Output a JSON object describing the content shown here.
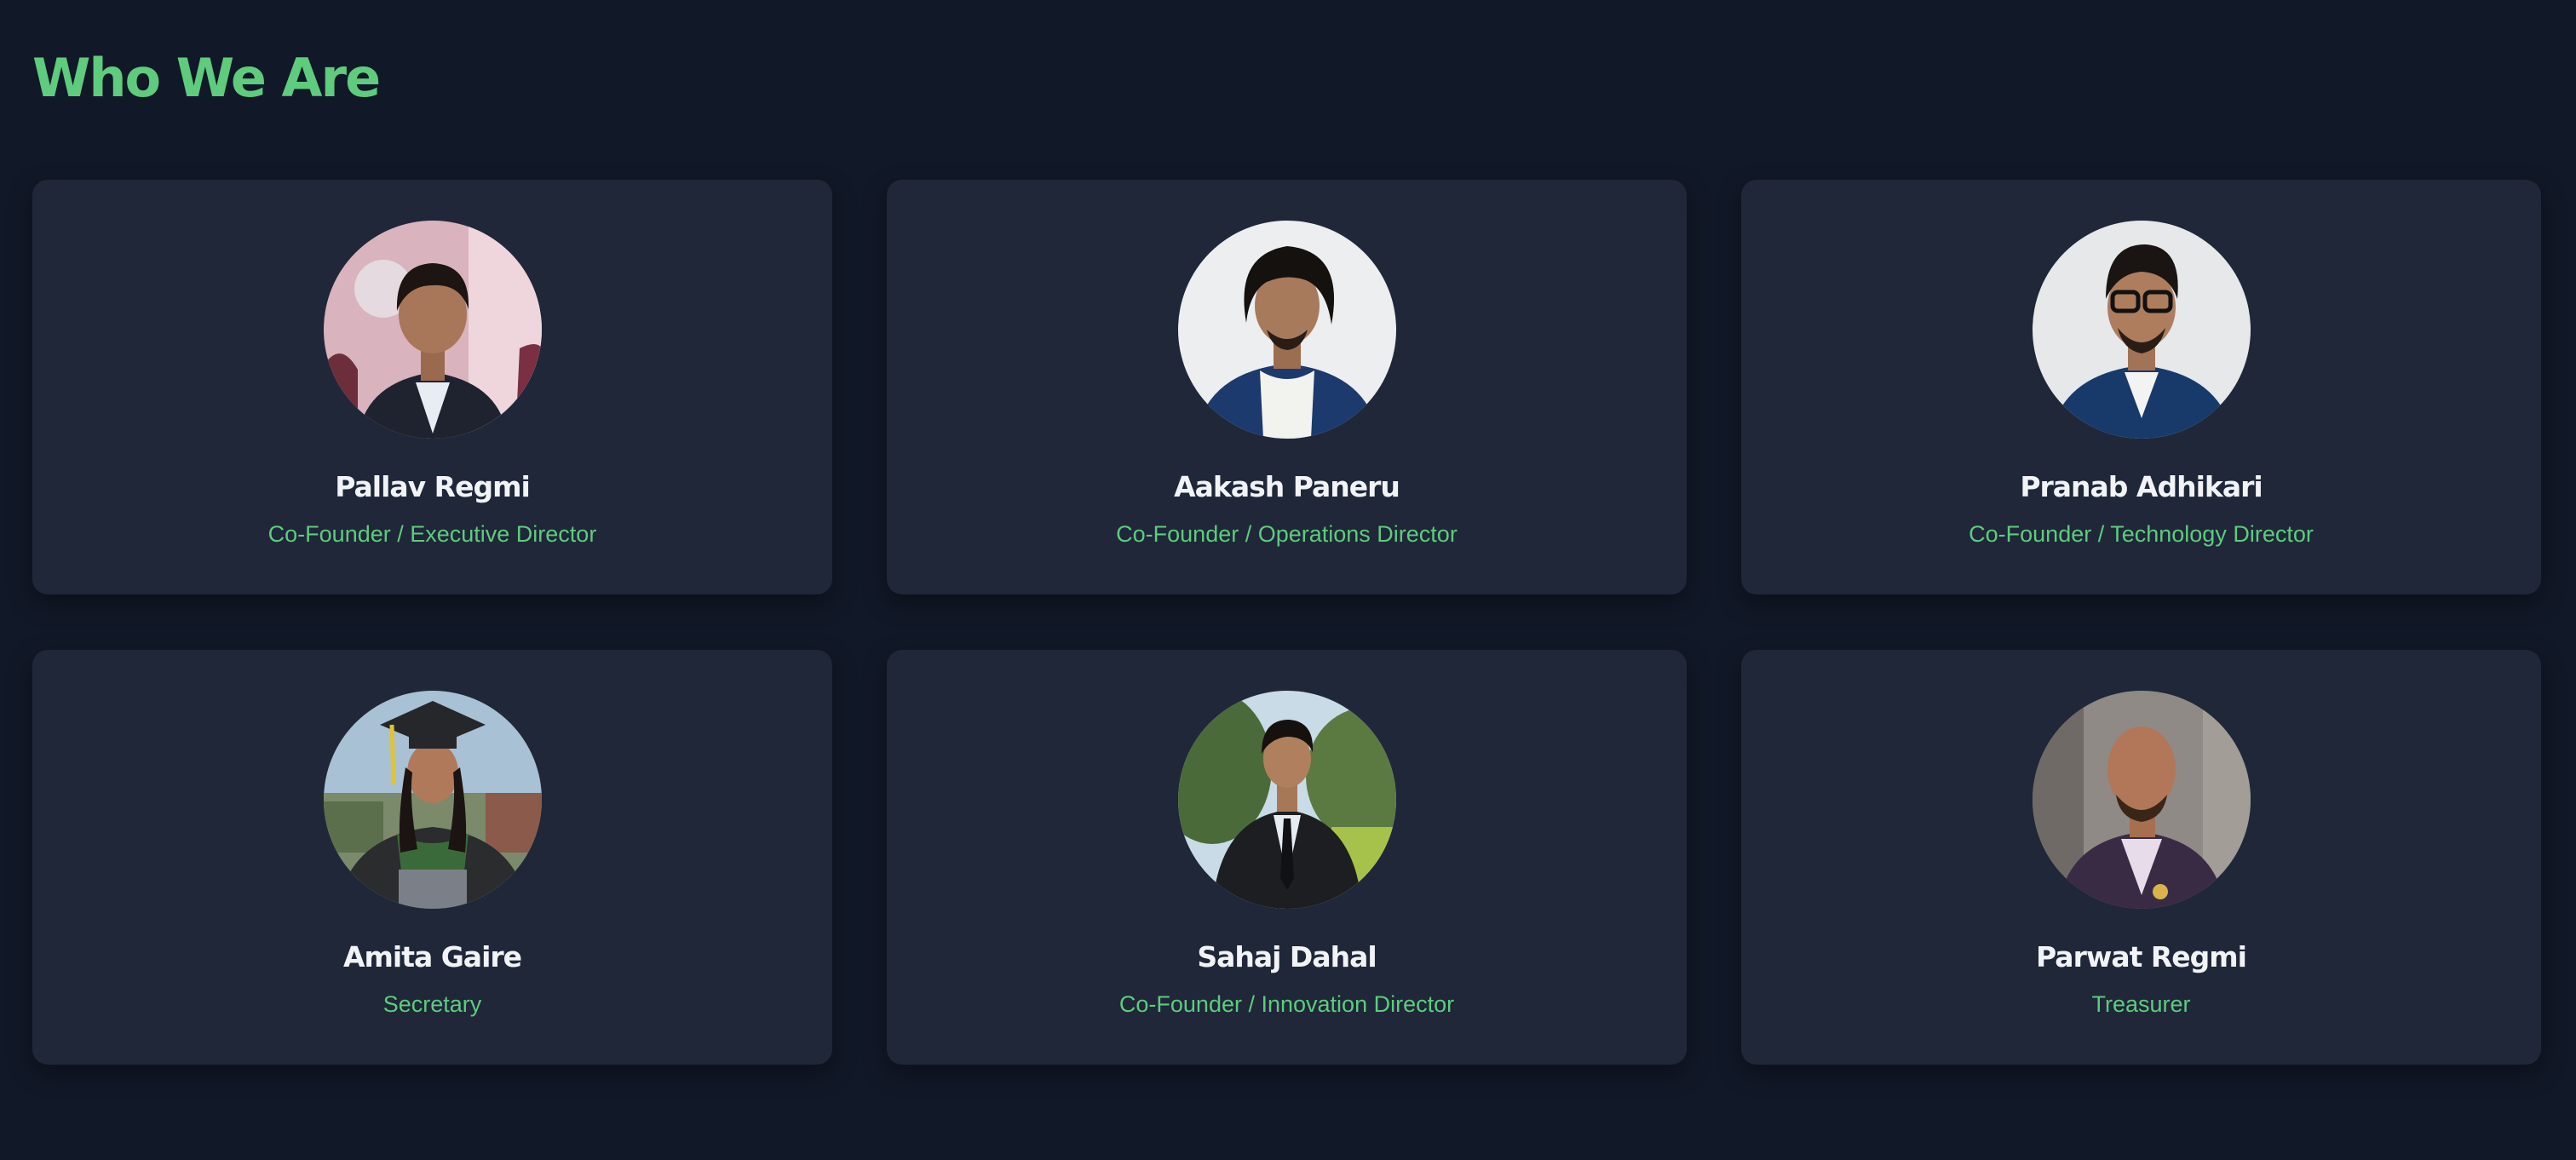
{
  "page": {
    "title": "Who We Are",
    "colors": {
      "background": "#111827",
      "card": "#1f2739",
      "accent": "#5ecb7d",
      "name_text": "#f1f3f6"
    }
  },
  "team": [
    {
      "name": "Pallav Regmi",
      "role": "Co-Founder / Executive Director",
      "photo": "portrait-photo"
    },
    {
      "name": "Aakash Paneru",
      "role": "Co-Founder / Operations Director",
      "photo": "portrait-photo"
    },
    {
      "name": "Pranab Adhikari",
      "role": "Co-Founder / Technology Director",
      "photo": "portrait-photo"
    },
    {
      "name": "Amita Gaire",
      "role": "Secretary",
      "photo": "portrait-photo"
    },
    {
      "name": "Sahaj Dahal",
      "role": "Co-Founder / Innovation Director",
      "photo": "portrait-photo"
    },
    {
      "name": "Parwat Regmi",
      "role": "Treasurer",
      "photo": "portrait-photo"
    }
  ]
}
